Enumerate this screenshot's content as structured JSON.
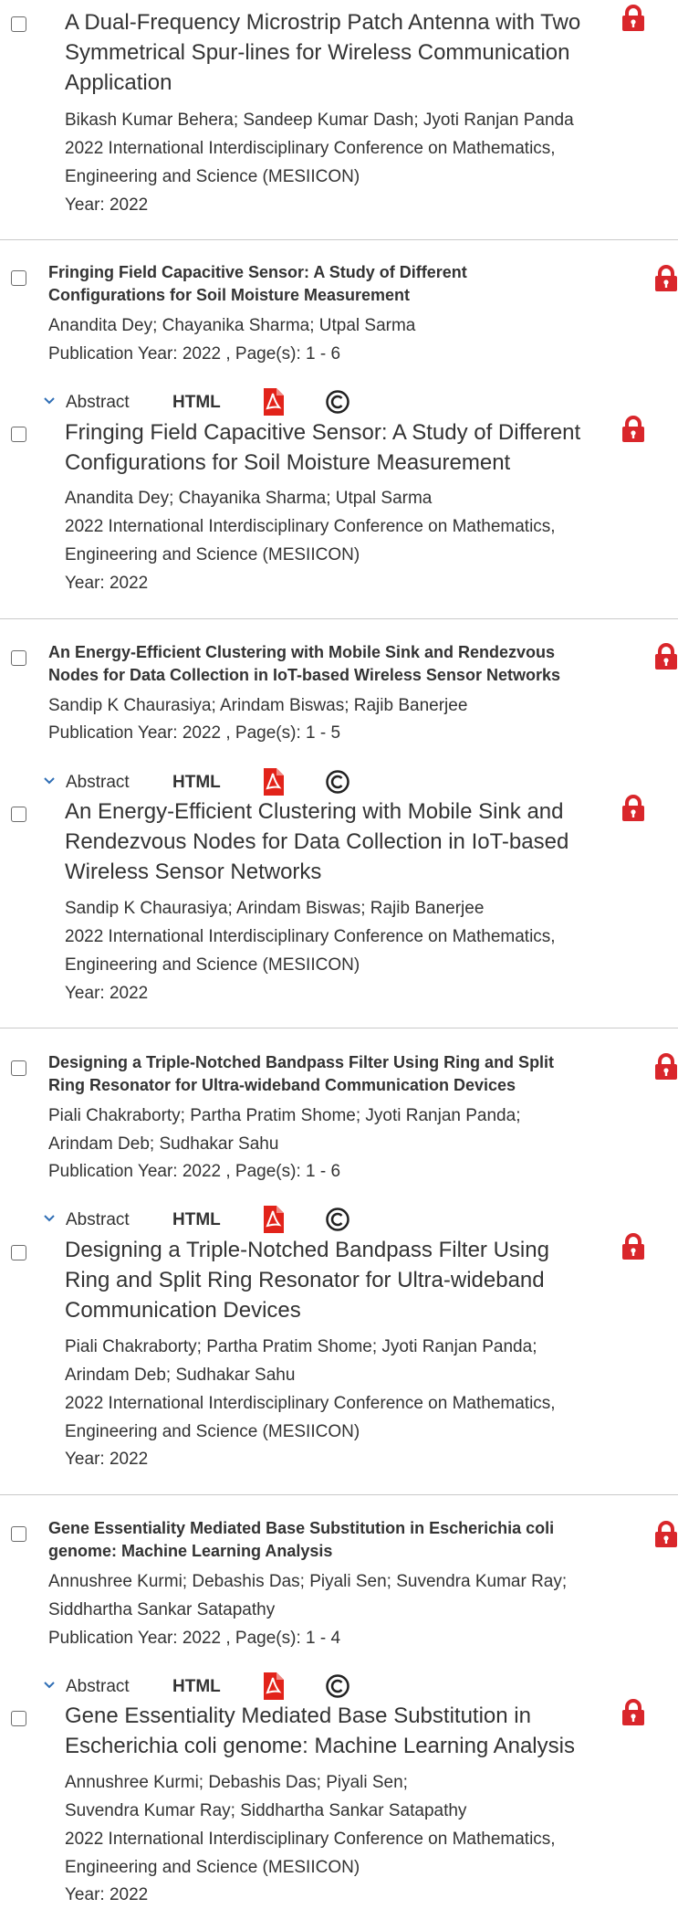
{
  "venue": "2022 International Interdisciplinary Conference on Mathematics, Engineering and Science (MESIICON)",
  "venue_lines": [
    "2022 International Interdisciplinary Conference on Mathematics,",
    "Engineering and Science (MESIICON)"
  ],
  "year_label": "Year: 2022",
  "action_labels": {
    "abstract": "Abstract",
    "html": "HTML"
  },
  "icon_names": {
    "lock": "lock-icon",
    "pdf": "pdf-icon",
    "copyright": "copyright-icon",
    "expand": "chevron-down-icon"
  },
  "colors": {
    "lock": "#d9262b",
    "pdf": "#e2231a",
    "separator": "#c9c9c9",
    "text": "#333333"
  },
  "card_0": {
    "title_lines": [
      "A Dual-Frequency Microstrip Patch Antenna with Two",
      "Symmetrical Spur-lines for Wireless Communication",
      "Application"
    ],
    "authors_lines": [
      "Bikash Kumar Behera; Sandeep Kumar Dash; Jyoti Ranjan Panda"
    ]
  },
  "item_1": {
    "title_lines": [
      "Fringing Field Capacitive Sensor: A Study of Different",
      "Configurations for Soil Moisture Measurement"
    ],
    "authors_lines": [
      "Anandita Dey; Chayanika Sharma; Utpal Sarma"
    ],
    "pub": "Publication Year: 2022 , Page(s): 1  -  6"
  },
  "card_1": {
    "title_lines": [
      "Fringing Field Capacitive Sensor: A Study of Different",
      "Configurations for Soil Moisture Measurement"
    ],
    "authors_lines": [
      "Anandita Dey; Chayanika Sharma; Utpal Sarma"
    ]
  },
  "item_2": {
    "title_lines": [
      "An Energy-Efficient Clustering with Mobile Sink and Rendezvous",
      "Nodes for Data Collection in IoT-based Wireless Sensor Networks"
    ],
    "authors_lines": [
      "Sandip K Chaurasiya; Arindam Biswas; Rajib Banerjee"
    ],
    "pub": "Publication Year: 2022 , Page(s): 1  -  5"
  },
  "card_2": {
    "title_lines": [
      "An Energy-Efficient Clustering with Mobile Sink and",
      "Rendezvous Nodes for Data Collection in IoT-based",
      "Wireless Sensor Networks"
    ],
    "authors_lines": [
      "Sandip K Chaurasiya; Arindam Biswas; Rajib Banerjee"
    ]
  },
  "item_3": {
    "title_lines": [
      "Designing a Triple-Notched Bandpass Filter Using Ring and Split",
      "Ring Resonator for Ultra-wideband Communication Devices"
    ],
    "authors_lines": [
      "Piali Chakraborty; Partha Pratim Shome; Jyoti Ranjan Panda;",
      "Arindam Deb; Sudhakar Sahu"
    ],
    "pub": "Publication Year: 2022 , Page(s): 1  -  6"
  },
  "card_3": {
    "title_lines": [
      "Designing a Triple-Notched Bandpass Filter Using",
      "Ring and Split Ring Resonator for Ultra-wideband",
      "Communication Devices"
    ],
    "authors_lines": [
      "Piali Chakraborty; Partha Pratim Shome; Jyoti Ranjan Panda;",
      "Arindam Deb; Sudhakar Sahu"
    ]
  },
  "item_4": {
    "title_lines": [
      "Gene Essentiality Mediated Base Substitution in Escherichia coli",
      "genome: Machine Learning Analysis"
    ],
    "authors_lines": [
      "Annushree Kurmi; Debashis Das; Piyali Sen; Suvendra Kumar Ray;",
      "Siddhartha Sankar Satapathy"
    ],
    "pub": "Publication Year: 2022 , Page(s): 1  -  4"
  },
  "card_4": {
    "title_lines": [
      "Gene Essentiality Mediated Base Substitution in",
      "Escherichia coli genome: Machine Learning Analysis"
    ],
    "authors_lines": [
      "Annushree Kurmi; Debashis Das; Piyali Sen;",
      "Suvendra Kumar Ray; Siddhartha Sankar Satapathy"
    ]
  }
}
